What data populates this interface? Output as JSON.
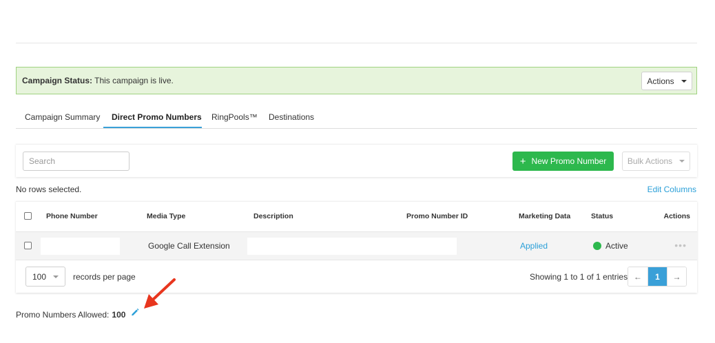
{
  "campaign_status": {
    "label": "Campaign Status:",
    "text": "This campaign is live.",
    "actions_label": "Actions"
  },
  "tabs": [
    {
      "label": "Campaign Summary"
    },
    {
      "label": "Direct Promo Numbers",
      "active": true
    },
    {
      "label": "RingPools™"
    },
    {
      "label": "Destinations"
    }
  ],
  "toolbar": {
    "search_placeholder": "Search",
    "new_button_label": "New Promo Number",
    "bulk_actions_label": "Bulk Actions"
  },
  "selection": {
    "rows_selected_text": "No rows selected.",
    "edit_columns_label": "Edit Columns"
  },
  "table": {
    "headers": [
      "Phone Number",
      "Media Type",
      "Description",
      "Promo Number ID",
      "Marketing Data",
      "Status",
      "Actions"
    ],
    "rows": [
      {
        "phone_number": "",
        "media_type": "Google Call Extension",
        "description": "",
        "promo_number_id": "",
        "marketing_data": "Applied",
        "status": "Active",
        "actions_icon": "ellipsis-icon"
      }
    ]
  },
  "pagination": {
    "per_page_value": "100",
    "per_page_label": "records per page",
    "showing_text": "Showing 1 to 1 of 1 entries",
    "prev_label": "←",
    "current_page": "1",
    "next_label": "→"
  },
  "allowance": {
    "label": "Promo Numbers Allowed:",
    "value": "100",
    "edit_icon": "pencil-icon"
  },
  "colors": {
    "status_bg": "#e7f4dc",
    "status_border": "#9fd27f",
    "primary_green": "#2db84d",
    "link_blue": "#2a9fd8",
    "annotation_red": "#e8361e"
  }
}
